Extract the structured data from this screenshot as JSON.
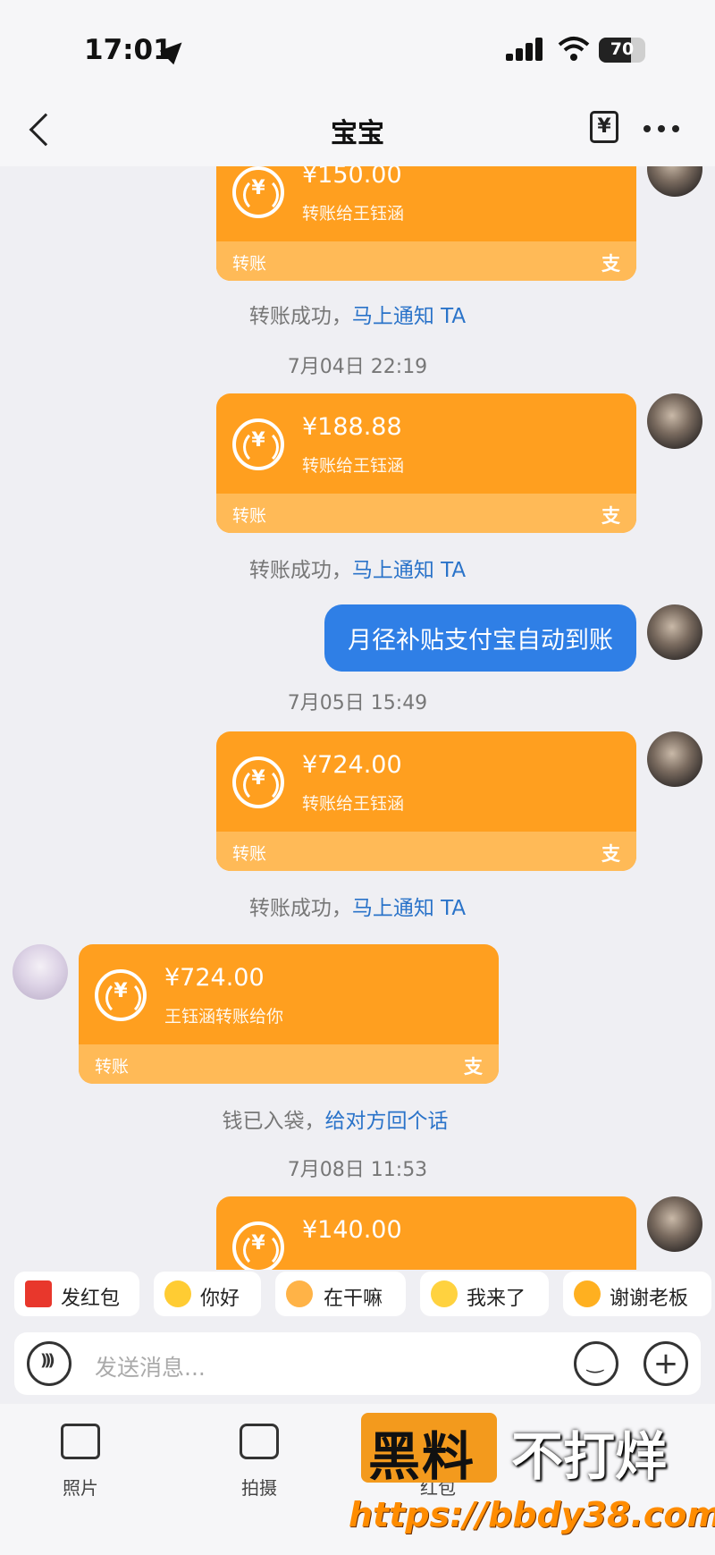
{
  "status_bar": {
    "time": "17:01",
    "battery": "70",
    "battery_level": 0.7
  },
  "nav": {
    "title": "宝宝"
  },
  "messages": [
    {
      "type": "transfer",
      "amount": "¥150.00",
      "desc": "转账给王钰涵",
      "label": "转账",
      "note": "转账成功，",
      "note_link": "马上通知 TA"
    },
    {
      "type": "timestamp",
      "text": "7月04日 22:19"
    },
    {
      "type": "transfer",
      "amount": "¥188.88",
      "desc": "转账给王钰涵",
      "label": "转账",
      "note": "转账成功，",
      "note_link": "马上通知 TA"
    },
    {
      "type": "text",
      "text": "月径补贴支付宝自动到账"
    },
    {
      "type": "timestamp",
      "text": "7月05日 15:49"
    },
    {
      "type": "transfer",
      "amount": "¥724.00",
      "desc": "转账给王钰涵",
      "label": "转账",
      "note": "转账成功，",
      "note_link": "马上通知 TA"
    },
    {
      "type": "transfer_in",
      "amount": "¥724.00",
      "desc": "王钰涵转账给你",
      "label": "转账",
      "note": "钱已入袋，",
      "note_link": "给对方回个话"
    },
    {
      "type": "timestamp",
      "text": "7月08日 11:53"
    },
    {
      "type": "transfer",
      "amount": "¥140.00"
    }
  ],
  "alipay_mark": "支",
  "quick_replies": [
    "发红包",
    "你好",
    "在干嘛",
    "我来了",
    "谢谢老板"
  ],
  "input": {
    "placeholder": "发送消息..."
  },
  "toolbar": {
    "photo": "照片",
    "camera": "拍摄",
    "redpacket": "红包"
  },
  "watermark": {
    "box_text": "黑料",
    "text": "不打烊",
    "url": "https://bbdy38.com"
  },
  "colors": {
    "transfer": "#ff9f1f",
    "transfer_footer": "#ffba57",
    "bubble": "#2f7fe6",
    "link": "#2a73c9"
  }
}
